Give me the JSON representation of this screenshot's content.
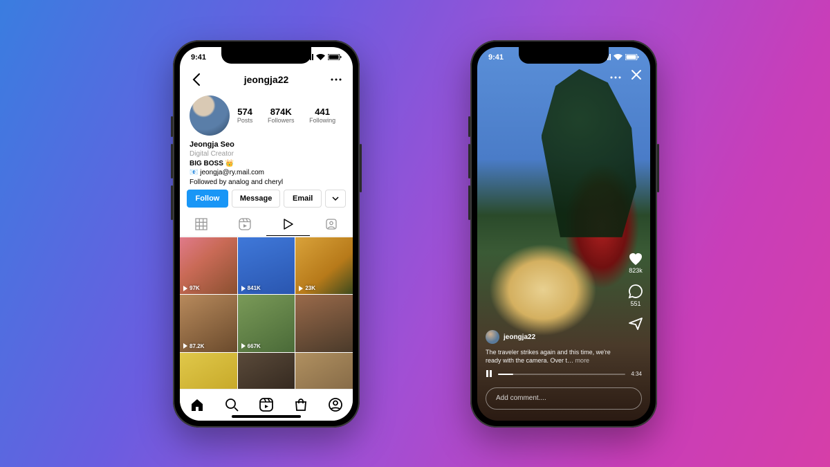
{
  "status": {
    "time": "9:41"
  },
  "profile": {
    "username": "jeongja22",
    "stats": [
      {
        "value": "574",
        "label": "Posts"
      },
      {
        "value": "874K",
        "label": "Followers"
      },
      {
        "value": "441",
        "label": "Following"
      }
    ],
    "display_name": "Jeongja Seo",
    "category": "Digital Creator",
    "bio_line": "BIG BOSS 👑",
    "email_line": "📧 jeongja@ry.mail.com",
    "followed_by": "Followed by analog and cheryl",
    "actions": {
      "follow": "Follow",
      "message": "Message",
      "email": "Email"
    },
    "grid_overlays": [
      "97K",
      "841K",
      "23K",
      "87.2K",
      "667K",
      "",
      "",
      "",
      ""
    ]
  },
  "video": {
    "username": "jeongja22",
    "caption": "The traveler strikes again and this time, we're ready with the camera. Over t…",
    "more": "more",
    "likes": "823k",
    "comments": "551",
    "duration": "4:34",
    "comment_placeholder": "Add comment...."
  }
}
